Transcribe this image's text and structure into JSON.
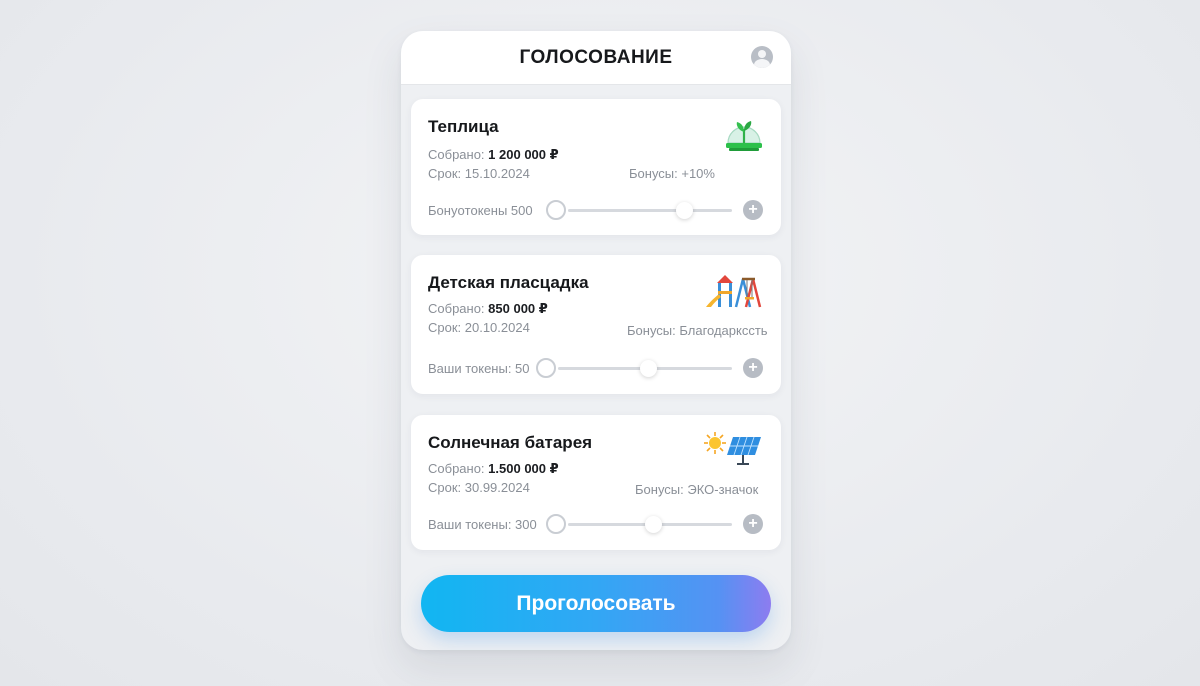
{
  "header": {
    "title": "ГОЛОСОВАНИЕ",
    "avatar_icon": "user-avatar-icon"
  },
  "projects": [
    {
      "title": "Теплица",
      "collected_label": "Собрано:",
      "collected_value": "1 200 000 ₽",
      "deadline": "Срок: 15.10.2024",
      "bonus": "Бонусы: +10%",
      "tokens_label": "Бонуοтокены 500",
      "icon": "greenhouse-icon",
      "slider_fraction": 0.71
    },
    {
      "title": "Детская пласцадка",
      "collected_label": "Собрано:",
      "collected_value": "850 000 ₽",
      "deadline": "Срок: 20.10.2024",
      "bonus": "Бонусы: Благодаркссть",
      "tokens_label": "Ваши токены: 50",
      "icon": "playground-icon",
      "slider_fraction": 0.52
    },
    {
      "title": "Солнечная батарея",
      "collected_label": "Собрано:",
      "collected_value": "1.500 000 ₽",
      "deadline": "Срок: 30.99.2024",
      "bonus": "Бонусы: ЭКО-значок",
      "tokens_label": "Ваши токены: 300",
      "icon": "solar-panel-icon",
      "slider_fraction": 0.52
    }
  ],
  "actions": {
    "vote_label": "Проголосовать"
  },
  "colors": {
    "accent_start": "#11b6f2",
    "accent_end": "#8d7cf0",
    "background": "#eceef1"
  }
}
